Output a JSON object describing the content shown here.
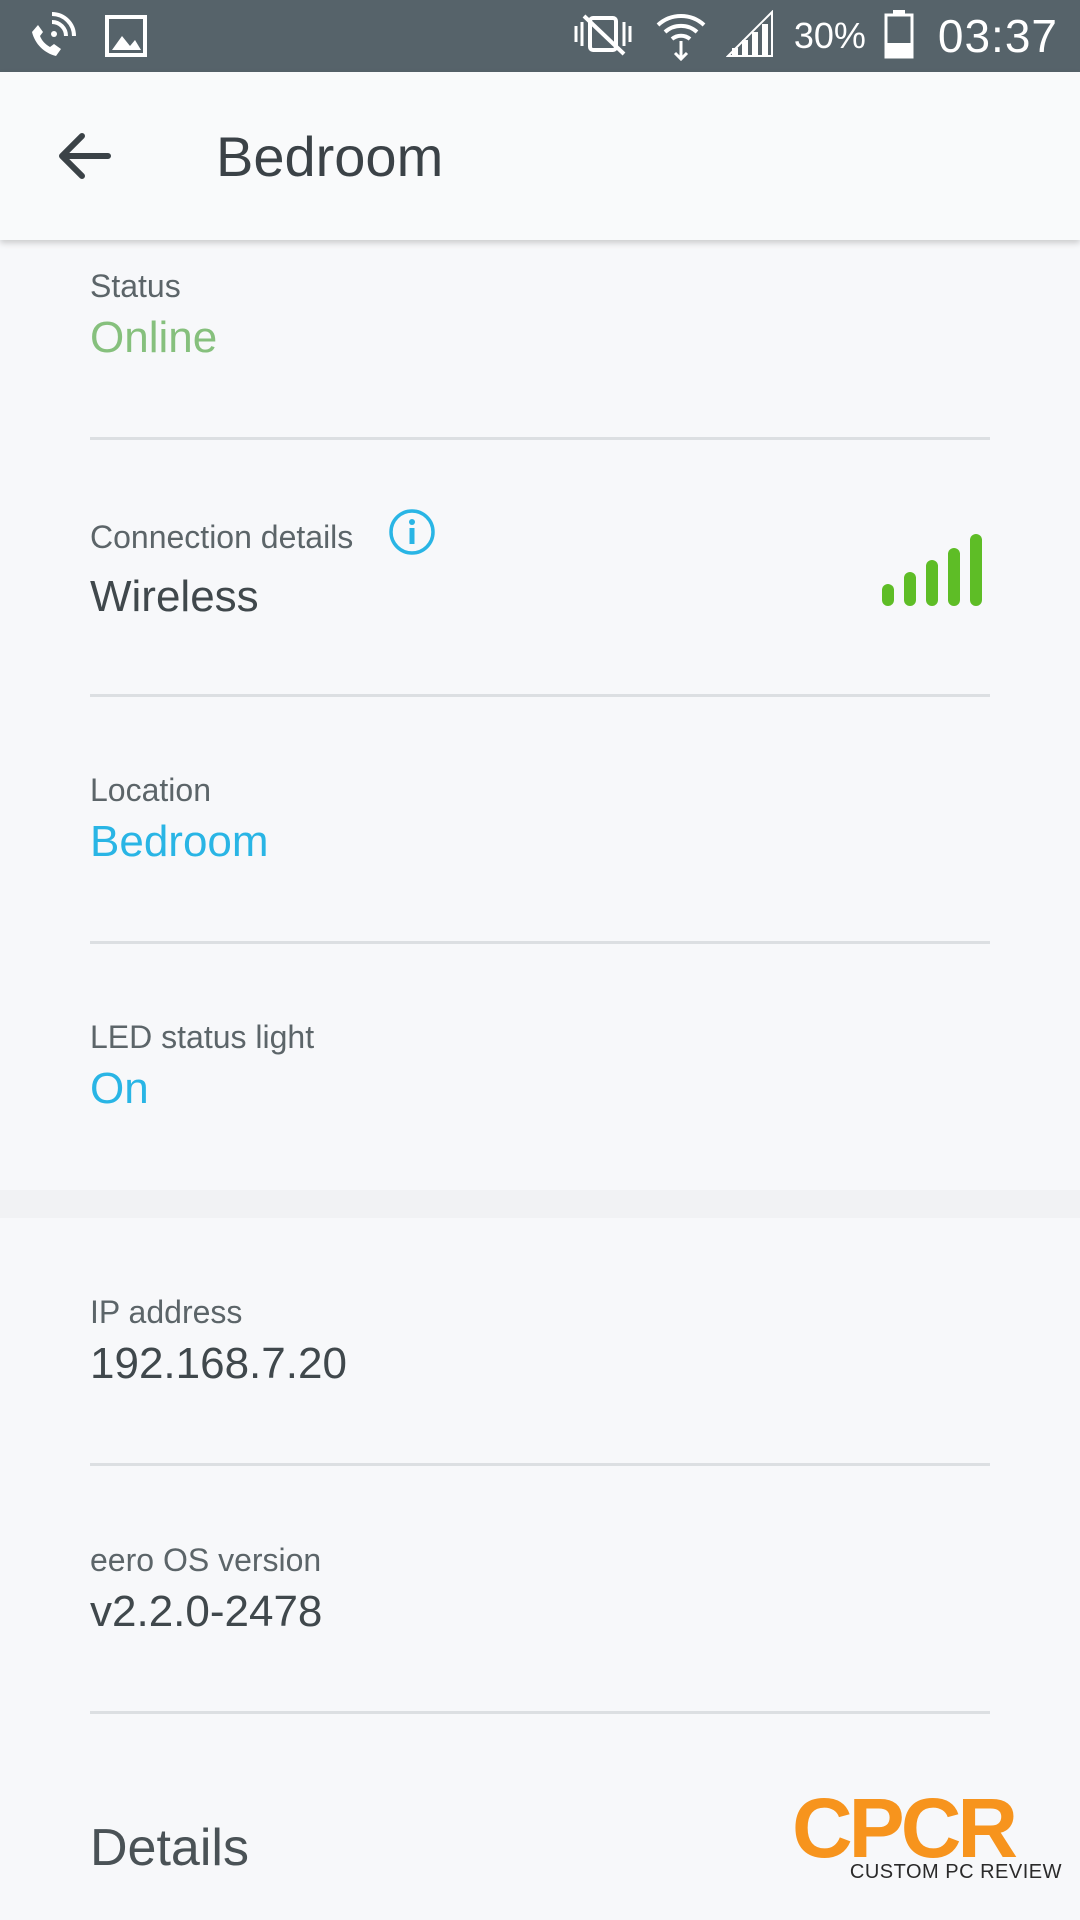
{
  "status_bar": {
    "battery_percent": "30%",
    "time": "03:37",
    "icons": [
      "wifi-calling-icon",
      "image-icon",
      "vibrate-muted-icon",
      "wifi-icon",
      "cell-signal-icon",
      "battery-icon"
    ]
  },
  "app_bar": {
    "title": "Bedroom"
  },
  "rows": {
    "status": {
      "label": "Status",
      "value": "Online"
    },
    "connection": {
      "label": "Connection details",
      "value": "Wireless",
      "signal_bars": 5
    },
    "location": {
      "label": "Location",
      "value": "Bedroom"
    },
    "led": {
      "label": "LED status light",
      "value": "On"
    },
    "ip": {
      "label": "IP address",
      "value": "192.168.7.20"
    },
    "os": {
      "label": "eero OS version",
      "value": "v2.2.0-2478"
    }
  },
  "details": {
    "title": "Details"
  },
  "watermark": {
    "logo": "CPCR",
    "text": "CUSTOM PC REVIEW"
  },
  "colors": {
    "status_bar": "#56636a",
    "online_green": "#86c07d",
    "accent_blue": "#29b5e5",
    "signal_green": "#5ebd26",
    "watermark_orange": "#f7941d"
  }
}
